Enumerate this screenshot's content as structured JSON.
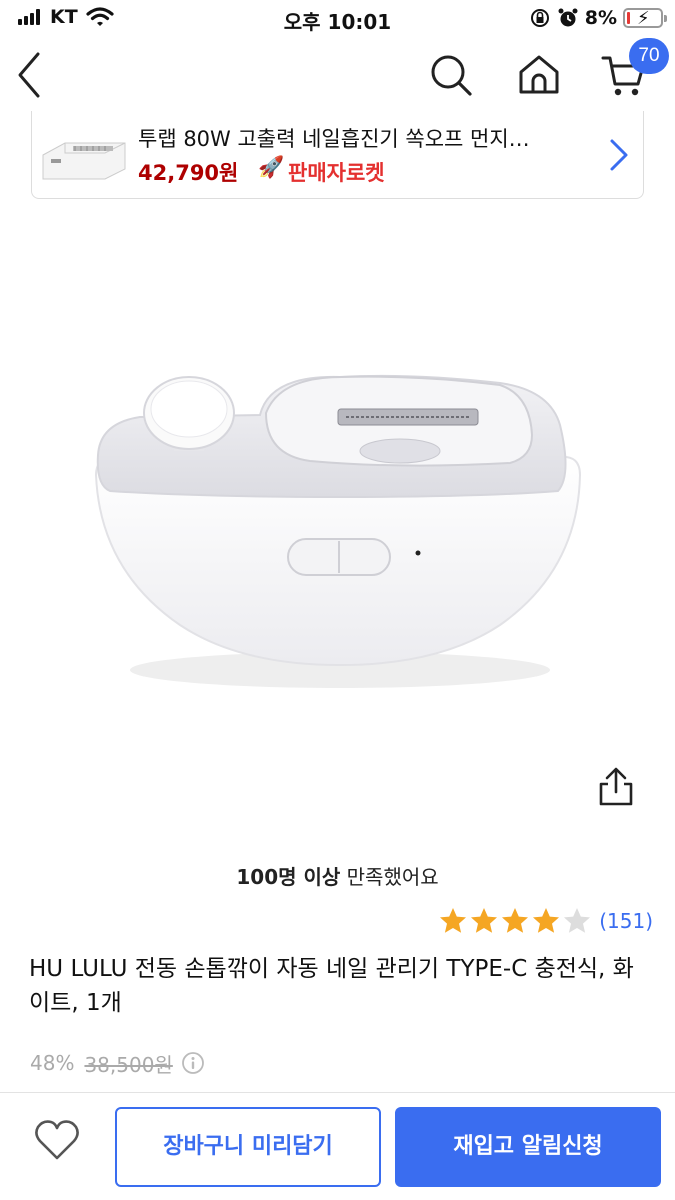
{
  "status_bar": {
    "carrier": "KT",
    "time": "오후 10:01",
    "battery_percent": "8%"
  },
  "nav": {
    "cart_count": "70",
    "icons": [
      "back-icon",
      "search-icon",
      "home-icon",
      "cart-icon"
    ]
  },
  "promo": {
    "title": "투랩 80W 고출력 네일흡진기 쏙오프 먼지…",
    "price": "42,790원",
    "badge": "판매자로켓",
    "rocket_icon": "🚀"
  },
  "product": {
    "satisfaction_bold": "100명 이상",
    "satisfaction_rest": " 만족했어요",
    "rating_stars": 4,
    "rating_max": 5,
    "review_count": "(151)",
    "name": "HU LULU 전동 손톱깎이 자동 네일 관리기 TYPE-C 충전식, 화이트, 1개",
    "discount": "48%",
    "original_price": "38,500원"
  },
  "bottom_bar": {
    "cart_preview_label": "장바구니 미리담기",
    "restock_label": "재입고 알림신청"
  },
  "colors": {
    "accent": "#3a6df0",
    "promo_price": "#ae0000",
    "badge": "#e4302f",
    "star_on": "#f5a623",
    "star_off": "#dddddd"
  }
}
